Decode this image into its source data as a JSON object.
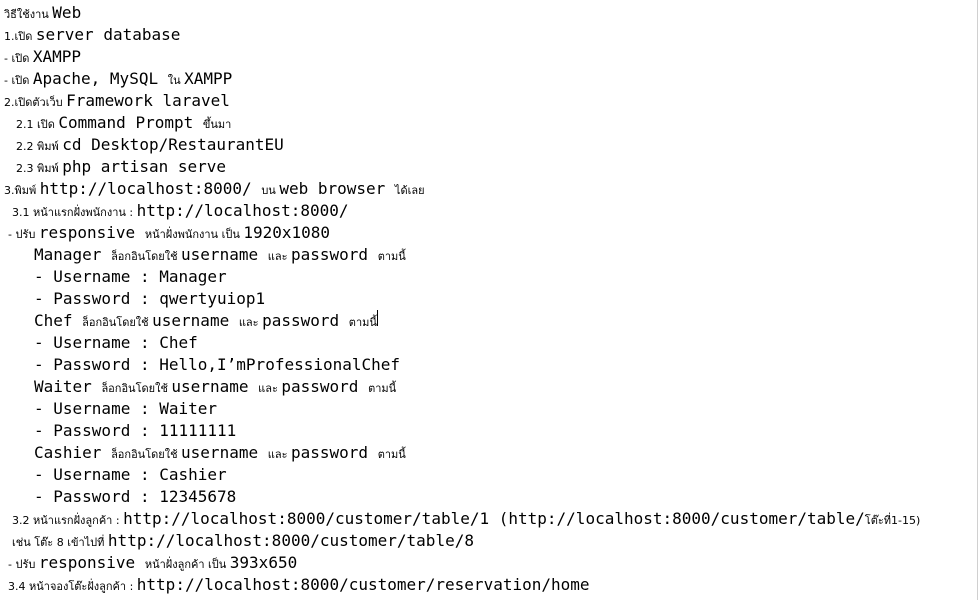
{
  "lines": [
    {
      "indent": 4,
      "parts": [
        {
          "t": "th",
          "v": "วิธีใช้งาน "
        },
        {
          "t": "mono",
          "v": "Web"
        }
      ]
    },
    {
      "indent": 4,
      "parts": [
        {
          "t": "th",
          "v": "1.เปิด "
        },
        {
          "t": "mono",
          "v": "server database"
        }
      ]
    },
    {
      "indent": 4,
      "parts": [
        {
          "t": "th",
          "v": "- เปิด "
        },
        {
          "t": "mono",
          "v": "XAMPP"
        }
      ]
    },
    {
      "indent": 4,
      "parts": [
        {
          "t": "th",
          "v": "- เปิด "
        },
        {
          "t": "mono",
          "v": "Apache, MySQL "
        },
        {
          "t": "th",
          "v": "ใน "
        },
        {
          "t": "mono",
          "v": "XAMPP"
        }
      ]
    },
    {
      "indent": 4,
      "parts": [
        {
          "t": "th",
          "v": "2.เปิดตัวเว็บ "
        },
        {
          "t": "mono",
          "v": "Framework laravel"
        }
      ]
    },
    {
      "indent": 16,
      "parts": [
        {
          "t": "th",
          "v": "2.1 เปิด "
        },
        {
          "t": "mono",
          "v": "Command Prompt "
        },
        {
          "t": "th",
          "v": "ขึ้นมา"
        }
      ]
    },
    {
      "indent": 16,
      "parts": [
        {
          "t": "th",
          "v": "2.2 พิมพ์ "
        },
        {
          "t": "mono",
          "v": "cd Desktop/RestaurantEU"
        }
      ]
    },
    {
      "indent": 16,
      "parts": [
        {
          "t": "th",
          "v": "2.3 พิมพ์ "
        },
        {
          "t": "mono",
          "v": "php artisan serve"
        }
      ]
    },
    {
      "indent": 4,
      "parts": [
        {
          "t": "th",
          "v": "3.พิมพ์ "
        },
        {
          "t": "mono",
          "v": "http://localhost:8000/ "
        },
        {
          "t": "th",
          "v": "บน "
        },
        {
          "t": "mono",
          "v": "web browser "
        },
        {
          "t": "th",
          "v": "ได้เลย"
        }
      ]
    },
    {
      "indent": 12,
      "parts": [
        {
          "t": "th",
          "v": "3.1 หน้าแรกฝั่งพนักงาน : "
        },
        {
          "t": "mono",
          "v": "http://localhost:8000/"
        }
      ]
    },
    {
      "indent": 8,
      "parts": [
        {
          "t": "th",
          "v": "- ปรับ "
        },
        {
          "t": "mono",
          "v": "responsive "
        },
        {
          "t": "th",
          "v": "หน้าฝั่งพนักงาน เป็น "
        },
        {
          "t": "mono",
          "v": "1920x1080"
        }
      ]
    },
    {
      "indent": 34,
      "parts": [
        {
          "t": "mono",
          "v": "Manager "
        },
        {
          "t": "th",
          "v": "ล็อกอินโดยใช้ "
        },
        {
          "t": "mono",
          "v": "username "
        },
        {
          "t": "th",
          "v": "และ "
        },
        {
          "t": "mono",
          "v": "password "
        },
        {
          "t": "th",
          "v": "ตามนี้"
        }
      ]
    },
    {
      "indent": 34,
      "parts": [
        {
          "t": "mono",
          "v": "- Username : Manager"
        }
      ]
    },
    {
      "indent": 34,
      "parts": [
        {
          "t": "mono",
          "v": "- Password : qwertyuiop1"
        }
      ]
    },
    {
      "indent": 34,
      "parts": [
        {
          "t": "mono",
          "v": "Chef "
        },
        {
          "t": "th",
          "v": "ล็อกอินโดยใช้ "
        },
        {
          "t": "mono",
          "v": "username "
        },
        {
          "t": "th",
          "v": "และ "
        },
        {
          "t": "mono",
          "v": "password "
        },
        {
          "t": "th",
          "v": "ตามนี้"
        }
      ],
      "cursor": true
    },
    {
      "indent": 34,
      "parts": [
        {
          "t": "mono",
          "v": "- Username : Chef"
        }
      ]
    },
    {
      "indent": 34,
      "parts": [
        {
          "t": "mono",
          "v": "- Password : Hello,I’mProfessionalChef"
        }
      ]
    },
    {
      "indent": 34,
      "parts": [
        {
          "t": "mono",
          "v": "Waiter "
        },
        {
          "t": "th",
          "v": "ล็อกอินโดยใช้ "
        },
        {
          "t": "mono",
          "v": "username "
        },
        {
          "t": "th",
          "v": "และ "
        },
        {
          "t": "mono",
          "v": "password "
        },
        {
          "t": "th",
          "v": "ตามนี้"
        }
      ]
    },
    {
      "indent": 34,
      "parts": [
        {
          "t": "mono",
          "v": "- Username : Waiter"
        }
      ]
    },
    {
      "indent": 34,
      "parts": [
        {
          "t": "mono",
          "v": "- Password : 11111111"
        }
      ]
    },
    {
      "indent": 34,
      "parts": [
        {
          "t": "mono",
          "v": "Cashier "
        },
        {
          "t": "th",
          "v": "ล็อกอินโดยใช้ "
        },
        {
          "t": "mono",
          "v": "username "
        },
        {
          "t": "th",
          "v": "และ "
        },
        {
          "t": "mono",
          "v": "password "
        },
        {
          "t": "th",
          "v": "ตามนี้"
        }
      ]
    },
    {
      "indent": 34,
      "parts": [
        {
          "t": "mono",
          "v": "- Username : Cashier"
        }
      ]
    },
    {
      "indent": 34,
      "parts": [
        {
          "t": "mono",
          "v": "- Password : 12345678"
        }
      ]
    },
    {
      "indent": 12,
      "parts": [
        {
          "t": "th",
          "v": "3.2 หน้าแรกฝั่งลูกค้า : "
        },
        {
          "t": "mono",
          "v": "http://localhost:8000/customer/table/1 (http://localhost:8000/customer/table/"
        },
        {
          "t": "th",
          "v": "โต๊ะที่1-15)"
        }
      ]
    },
    {
      "indent": 12,
      "parts": [
        {
          "t": "th",
          "v": "เช่น โต๊ะ 8 เข้าไปที่ "
        },
        {
          "t": "mono",
          "v": "http://localhost:8000/customer/table/8"
        }
      ]
    },
    {
      "indent": 8,
      "parts": [
        {
          "t": "th",
          "v": "- ปรับ "
        },
        {
          "t": "mono",
          "v": "responsive "
        },
        {
          "t": "th",
          "v": "หน้าฝั่งลูกค้า เป็น "
        },
        {
          "t": "mono",
          "v": "393x650"
        }
      ]
    },
    {
      "indent": 8,
      "parts": [
        {
          "t": "th",
          "v": "3.4 หน้าจองโต๊ะฝั่งลูกค้า : "
        },
        {
          "t": "mono",
          "v": "http://localhost:8000/customer/reservation/home"
        }
      ]
    }
  ]
}
